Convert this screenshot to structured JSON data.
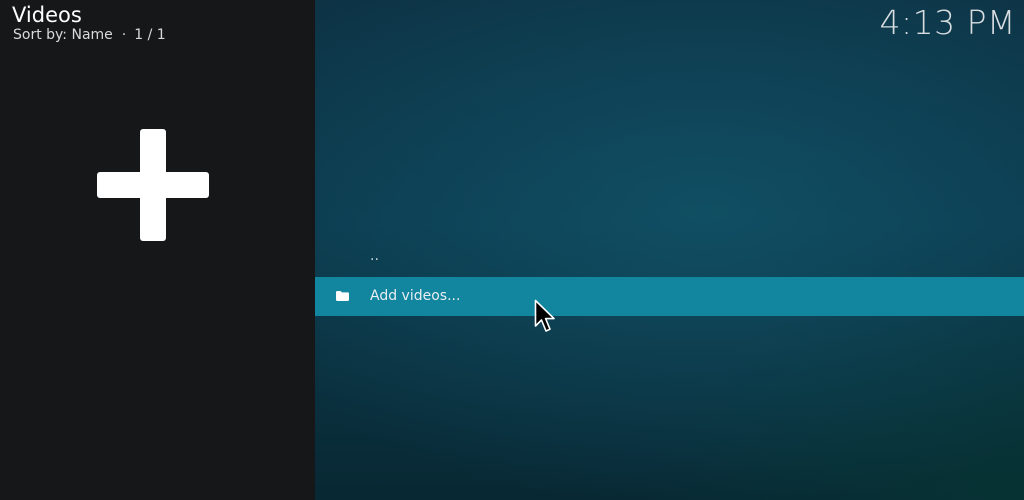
{
  "header": {
    "title": "Videos",
    "sort_label": "Sort by: Name",
    "separator": "·",
    "page_count": "1 / 1",
    "clock": "4:13 PM"
  },
  "sidebar": {
    "add_icon": "plus-icon"
  },
  "list": {
    "items": [
      {
        "label": "..",
        "icon": ""
      },
      {
        "label": "Add videos...",
        "icon": "folder-icon",
        "selected": true
      }
    ]
  },
  "colors": {
    "left_panel": "#151719",
    "main_background": "#0c3a4d",
    "selection": "#12859f",
    "text": "#ffffff"
  }
}
